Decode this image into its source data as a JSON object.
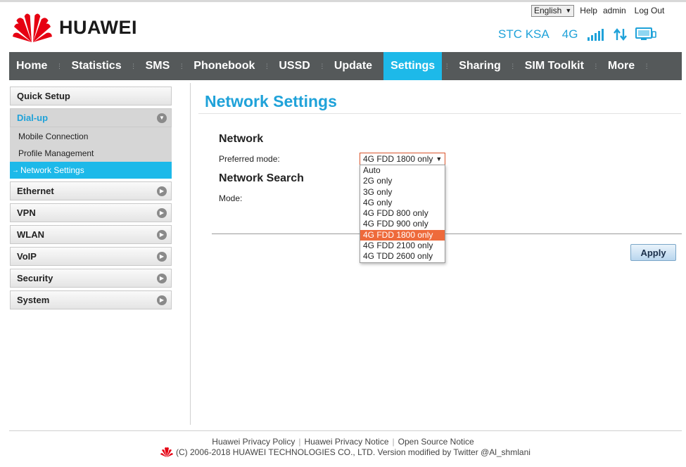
{
  "brand": {
    "name": "HUAWEI"
  },
  "top_links": {
    "language": "English",
    "help": "Help",
    "user": "admin",
    "logout": "Log Out"
  },
  "status": {
    "operator": "STC KSA",
    "network": "4G"
  },
  "nav": [
    {
      "label": "Home"
    },
    {
      "label": "Statistics"
    },
    {
      "label": "SMS"
    },
    {
      "label": "Phonebook"
    },
    {
      "label": "USSD"
    },
    {
      "label": "Update"
    },
    {
      "label": "Settings",
      "active": true
    },
    {
      "label": "Sharing"
    },
    {
      "label": "SIM Toolkit"
    },
    {
      "label": "More"
    }
  ],
  "sidebar": {
    "quick_setup": "Quick Setup",
    "dialup": {
      "label": "Dial-up",
      "items": [
        "Mobile Connection",
        "Profile Management",
        "Network Settings"
      ],
      "active_item": "Network Settings"
    },
    "sections": [
      "Ethernet",
      "VPN",
      "WLAN",
      "VoIP",
      "Security",
      "System"
    ]
  },
  "main": {
    "title": "Network Settings",
    "network_heading": "Network",
    "preferred_mode_label": "Preferred mode:",
    "preferred_mode_value": "4G FDD 1800 only",
    "mode_options": [
      "Auto",
      "2G only",
      "3G only",
      "4G only",
      "4G FDD 800 only",
      "4G FDD 900 only",
      "4G FDD 1800 only",
      "4G FDD 2100 only",
      "4G TDD 2600 only"
    ],
    "selected_index": 6,
    "search_heading": "Network Search",
    "mode_label": "Mode:",
    "apply_label": "Apply"
  },
  "footer": {
    "links": [
      "Huawei Privacy Policy",
      "Huawei Privacy Notice",
      "Open Source Notice"
    ],
    "copyright": "(C) 2006-2018 HUAWEI TECHNOLOGIES CO., LTD. Version modified by Twitter @Al_shmlani"
  },
  "colors": {
    "accent": "#1db9e9",
    "nav_bg": "#55595a",
    "selection": "#ee6a3b",
    "brand_red": "#e60012"
  }
}
